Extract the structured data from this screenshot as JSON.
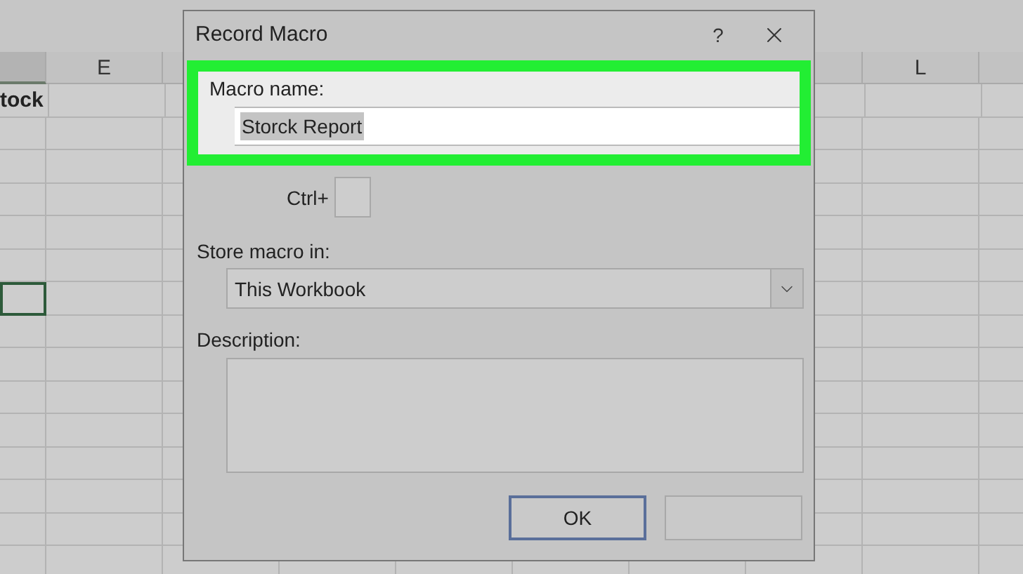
{
  "spreadsheet": {
    "columns": [
      {
        "selected": true
      },
      {
        "label": "E",
        "selected": false
      },
      {
        "selected": false
      },
      {
        "selected": false
      },
      {
        "label": "L",
        "selected": false
      },
      {
        "selected": false
      }
    ],
    "rows": [
      {
        "first_cell": "tock",
        "selected": false
      },
      {
        "selected": false
      },
      {
        "selected": false
      },
      {
        "selected": false
      },
      {
        "selected": false
      },
      {
        "selected": false
      },
      {
        "selected": true
      },
      {
        "selected": false
      },
      {
        "selected": false
      },
      {
        "selected": false
      },
      {
        "selected": false
      },
      {
        "selected": false
      },
      {
        "selected": false
      },
      {
        "selected": false
      },
      {
        "selected": false
      }
    ]
  },
  "dialog": {
    "title": "Record Macro",
    "help": "?",
    "macro_name": {
      "label": "Macro name:",
      "value": "Storck Report",
      "value_selected": true,
      "highlighted": true
    },
    "shortcut": {
      "prefix": "Ctrl+"
    },
    "store_in": {
      "label": "Store macro in:",
      "value": "This Workbook"
    },
    "description": {
      "label": "Description:"
    },
    "buttons": [
      {
        "label": "OK",
        "default": true
      },
      {
        "default": false
      }
    ]
  }
}
